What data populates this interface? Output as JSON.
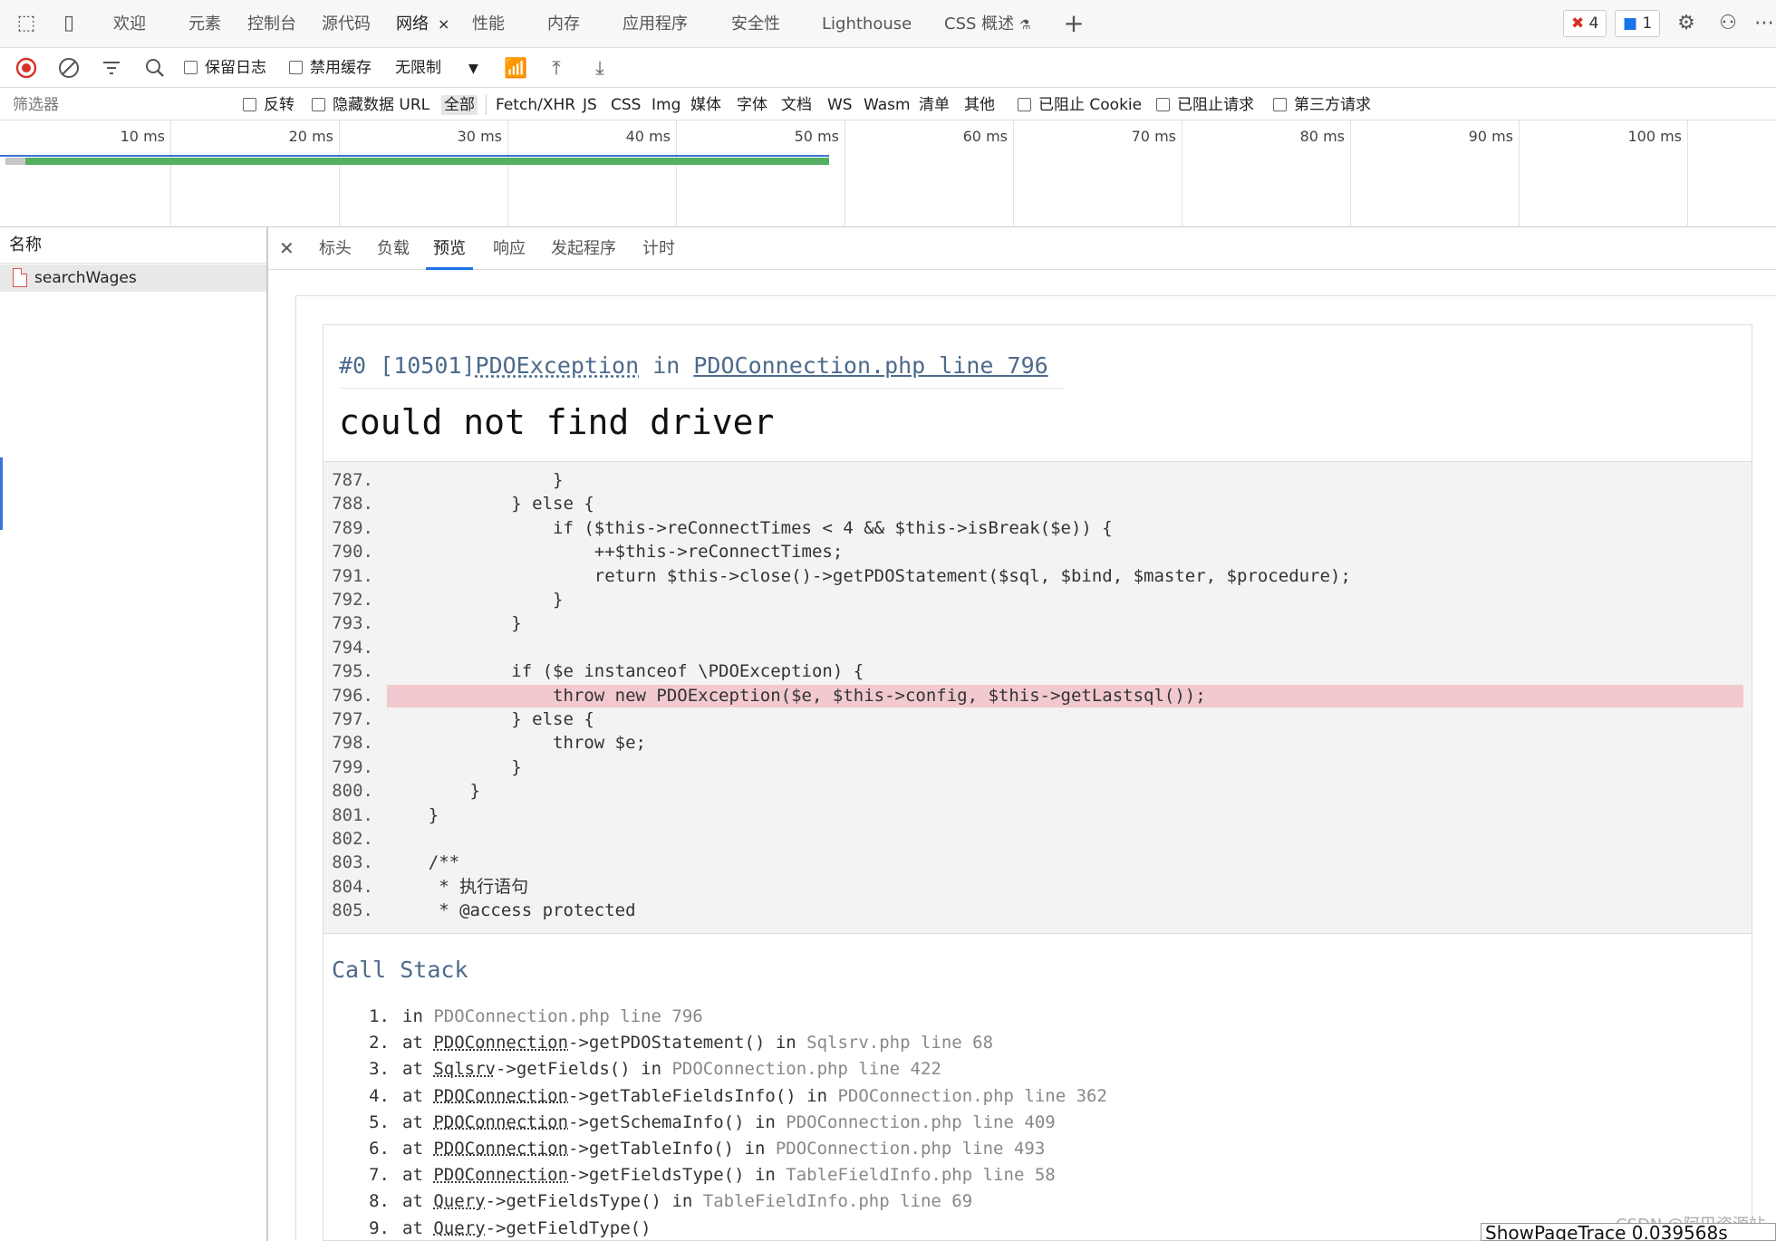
{
  "tabs": {
    "items": [
      {
        "label": "欢迎"
      },
      {
        "label": "元素"
      },
      {
        "label": "控制台"
      },
      {
        "label": "源代码"
      },
      {
        "label": "网络",
        "active": true
      },
      {
        "label": "性能"
      },
      {
        "label": "内存"
      },
      {
        "label": "应用程序"
      },
      {
        "label": "安全性"
      },
      {
        "label": "Lighthouse"
      },
      {
        "label": "CSS 概述"
      }
    ],
    "close_glyph": "×",
    "add_glyph": "+",
    "errors_count": "4",
    "issues_count": "1"
  },
  "toolbar": {
    "preserve_log": "保留日志",
    "disable_cache": "禁用缓存",
    "throttle": "无限制"
  },
  "filter": {
    "placeholder": "筛选器",
    "invert": "反转",
    "hide_data_urls": "隐藏数据 URL",
    "types": [
      "全部",
      "Fetch/XHR",
      "JS",
      "CSS",
      "Img",
      "媒体",
      "字体",
      "文档",
      "WS",
      "Wasm",
      "清单",
      "其他"
    ],
    "blocked_cookies": "已阻止 Cookie",
    "blocked_requests": "已阻止请求",
    "third_party": "第三方请求"
  },
  "timeline": {
    "ticks": [
      "10 ms",
      "20 ms",
      "30 ms",
      "40 ms",
      "50 ms",
      "60 ms",
      "70 ms",
      "80 ms",
      "90 ms",
      "100 ms"
    ]
  },
  "requests": {
    "header": "名称",
    "items": [
      {
        "name": "searchWages"
      }
    ]
  },
  "detail_tabs": [
    "标头",
    "负载",
    "预览",
    "响应",
    "发起程序",
    "计时"
  ],
  "exception": {
    "prefix": "#0 [10501]",
    "class": "PDOException",
    "in_word": " in ",
    "location": "PDOConnection.php line 796",
    "message": "could not find driver"
  },
  "code": [
    {
      "n": "787.",
      "t": "                }"
    },
    {
      "n": "788.",
      "t": "            } else {"
    },
    {
      "n": "789.",
      "t": "                if ($this->reConnectTimes < 4 && $this->isBreak($e)) {"
    },
    {
      "n": "790.",
      "t": "                    ++$this->reConnectTimes;"
    },
    {
      "n": "791.",
      "t": "                    return $this->close()->getPDOStatement($sql, $bind, $master, $procedure);"
    },
    {
      "n": "792.",
      "t": "                }"
    },
    {
      "n": "793.",
      "t": "            }"
    },
    {
      "n": "794.",
      "t": ""
    },
    {
      "n": "795.",
      "t": "            if ($e instanceof \\PDOException) {"
    },
    {
      "n": "796.",
      "t": "                throw new PDOException($e, $this->config, $this->getLastsql());",
      "hl": true
    },
    {
      "n": "797.",
      "t": "            } else {"
    },
    {
      "n": "798.",
      "t": "                throw $e;"
    },
    {
      "n": "799.",
      "t": "            }"
    },
    {
      "n": "800.",
      "t": "        }"
    },
    {
      "n": "801.",
      "t": "    }"
    },
    {
      "n": "802.",
      "t": ""
    },
    {
      "n": "803.",
      "t": "    /**"
    },
    {
      "n": "804.",
      "t": "     * 执行语句"
    },
    {
      "n": "805.",
      "t": "     * @access protected"
    }
  ],
  "call_stack": {
    "title": "Call Stack",
    "items": [
      {
        "n": "1.",
        "pre": "in ",
        "cls": "",
        "meth": "",
        "mid": "",
        "file": "PDOConnection.php line 796"
      },
      {
        "n": "2.",
        "pre": "at ",
        "cls": "PDOConnection",
        "meth": "->getPDOStatement()",
        "mid": " in ",
        "file": "Sqlsrv.php line 68"
      },
      {
        "n": "3.",
        "pre": "at ",
        "cls": "Sqlsrv",
        "meth": "->getFields()",
        "mid": " in ",
        "file": "PDOConnection.php line 422"
      },
      {
        "n": "4.",
        "pre": "at ",
        "cls": "PDOConnection",
        "meth": "->getTableFieldsInfo()",
        "mid": " in ",
        "file": "PDOConnection.php line 362"
      },
      {
        "n": "5.",
        "pre": "at ",
        "cls": "PDOConnection",
        "meth": "->getSchemaInfo()",
        "mid": " in ",
        "file": "PDOConnection.php line 409"
      },
      {
        "n": "6.",
        "pre": "at ",
        "cls": "PDOConnection",
        "meth": "->getTableInfo()",
        "mid": " in ",
        "file": "PDOConnection.php line 493"
      },
      {
        "n": "7.",
        "pre": "at ",
        "cls": "PDOConnection",
        "meth": "->getFieldsType()",
        "mid": " in ",
        "file": "TableFieldInfo.php line 58"
      },
      {
        "n": "8.",
        "pre": "at ",
        "cls": "Query",
        "meth": "->getFieldsType()",
        "mid": " in ",
        "file": "TableFieldInfo.php line 69"
      },
      {
        "n": "9.",
        "pre": "at ",
        "cls": "Query",
        "meth": "->getFieldType()",
        "mid": "",
        "file": ""
      }
    ]
  },
  "watermark": "CSDN @阿巴资源站",
  "trace_button": "ShowPageTrace 0.039568s",
  "colors": {
    "accent": "#1a73e8",
    "highlight": "#f1c9ce",
    "link": "#4d6a8c",
    "waterfall": "#55b062"
  }
}
